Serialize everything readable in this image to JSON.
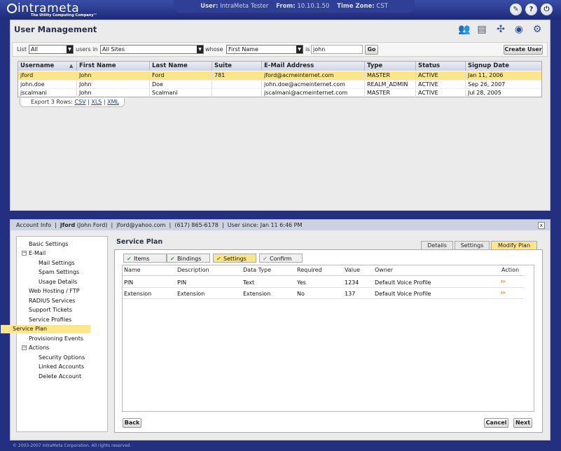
{
  "header": {
    "logo_text": "intrameta",
    "tagline": "The Utility Computing Company™",
    "user_label": "User:",
    "user_value": "IntraMeta Tester",
    "from_label": "From:",
    "from_value": "10.10.1.50",
    "tz_label": "Time Zone:",
    "tz_value": "CST",
    "icons": [
      "tools-icon",
      "help-icon",
      "power-icon"
    ]
  },
  "page": {
    "title": "User Management",
    "header_icons": [
      "users-icon",
      "card-icon",
      "network-icon",
      "globe-icon",
      "gears-icon"
    ]
  },
  "filter": {
    "list_label": "List",
    "list_value": "All",
    "users_in_label": "users in",
    "site_value": "All Sites",
    "whose_label": "whose",
    "field_value": "First Name",
    "is_label": "is",
    "search_value": "john",
    "go_label": "Go",
    "create_label": "Create User"
  },
  "grid": {
    "columns": [
      "Username",
      "First Name",
      "Last Name",
      "Suite",
      "E-Mail Address",
      "Type",
      "Status",
      "Signup Date"
    ],
    "rows": [
      [
        "jford",
        "John",
        "Ford",
        "781",
        "jford@acmeinternet.com",
        "MASTER",
        "ACTIVE",
        "Jan 11, 2006"
      ],
      [
        "john.doe",
        "John",
        "Doe",
        "",
        "john.doe@acmeinternet.com",
        "REALM_ADMIN",
        "ACTIVE",
        "Sep 26, 2007"
      ],
      [
        "jscalmani",
        "John",
        "Scalmani",
        "",
        "jscalmani@acmeinternet.com",
        "MASTER",
        "ACTIVE",
        "Jul 28, 2005"
      ]
    ],
    "export_label": "Export 3 Rows:",
    "export_csv": "CSV",
    "export_xls": "XLS",
    "export_xml": "XML"
  },
  "account_bar": {
    "label": "Account Info",
    "username": "jford",
    "fullname": "(John Ford)",
    "email": "jford@yahoo.com",
    "phone": "(617) 865-6178",
    "since": "User since: Jan 11 6:46 PM",
    "close": "x"
  },
  "tree": [
    {
      "label": "Basic Settings",
      "level": 0,
      "group": false
    },
    {
      "label": "E-Mail",
      "level": 0,
      "group": true
    },
    {
      "label": "Mail Settings",
      "level": 1,
      "group": false
    },
    {
      "label": "Spam Settings",
      "level": 1,
      "group": false
    },
    {
      "label": "Usage Details",
      "level": 1,
      "group": false
    },
    {
      "label": "Web Hosting / FTP",
      "level": 0,
      "group": false
    },
    {
      "label": "RADIUS Services",
      "level": 0,
      "group": false
    },
    {
      "label": "Support Tickets",
      "level": 0,
      "group": false
    },
    {
      "label": "Service Profiles",
      "level": 0,
      "group": false
    },
    {
      "label": "Service Plan",
      "level": 0,
      "group": false,
      "selected": true
    },
    {
      "label": "Provisioning Events",
      "level": 0,
      "group": false
    },
    {
      "label": "Actions",
      "level": 0,
      "group": true
    },
    {
      "label": "Security Options",
      "level": 1,
      "group": false
    },
    {
      "label": "Linked Accounts",
      "level": 1,
      "group": false
    },
    {
      "label": "Delete Account",
      "level": 1,
      "group": false
    }
  ],
  "service_plan": {
    "title": "Service Plan",
    "tabs": [
      "Details",
      "Settings",
      "Modify Plan"
    ],
    "steps": [
      "Items",
      "Bindings",
      "Settings",
      "Confirm"
    ],
    "columns": [
      "Name",
      "Description",
      "Data Type",
      "Required",
      "Value",
      "Owner",
      "Action"
    ],
    "rows": [
      [
        "PIN",
        "PIN",
        "Text",
        "Yes",
        "1234",
        "Default Voice Profile"
      ],
      [
        "Extension",
        "Extension",
        "Extension",
        "No",
        "137",
        "Default Voice Profile"
      ]
    ],
    "back_label": "Back",
    "cancel_label": "Cancel",
    "next_label": "Next"
  },
  "footer": "© 2003-2007 IntraMeta Corporation.  All rights reserved."
}
